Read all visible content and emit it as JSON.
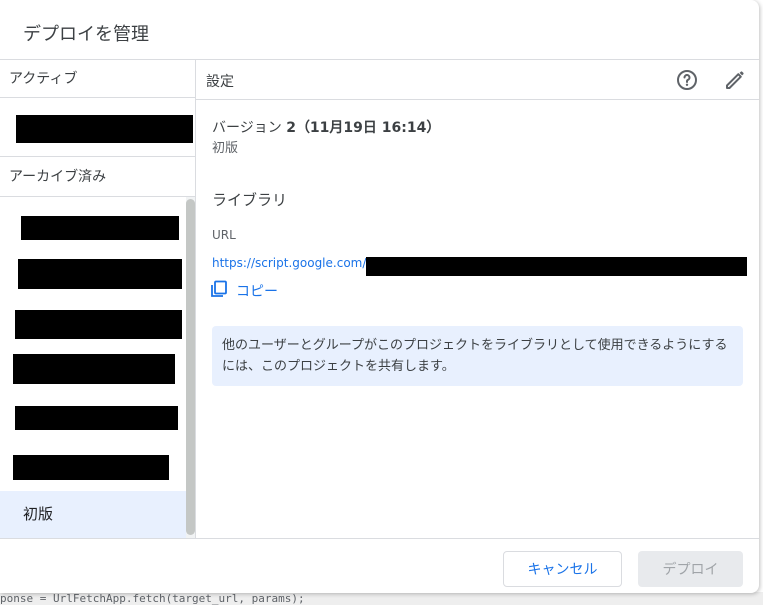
{
  "background": {
    "code_text": "ponse = UrlFetchApp.fetch(target_url, params);"
  },
  "dialog": {
    "title": "デプロイを管理"
  },
  "sidebar": {
    "active_header": "アクティブ",
    "archived_header": "アーカイブ済み",
    "selected_item": "初版"
  },
  "details": {
    "header_label": "設定",
    "help_icon": "help-circle-icon",
    "edit_icon": "pencil-icon",
    "version_prefix": "バージョン",
    "version_number": "2",
    "version_date": "（11月19日 16:14）",
    "version_description": "初版",
    "library_label": "ライブラリ",
    "url_label": "URL",
    "url_text": "https://script.google.com/",
    "copy_label": "コピー",
    "info_text": "他のユーザーとグループがこのプロジェクトをライブラリとして使用できるようにするには、このプロジェクトを共有します。"
  },
  "footer": {
    "cancel_label": "キャンセル",
    "deploy_label": "デプロイ"
  },
  "colors": {
    "accent": "#1a73e8",
    "selected_bg": "#e8f0fe",
    "divider": "#dadce0"
  }
}
